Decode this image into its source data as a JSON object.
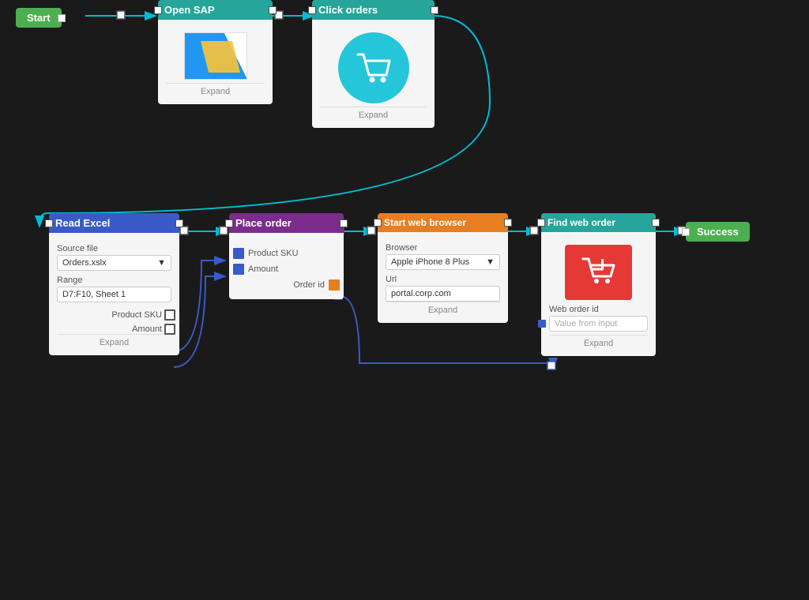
{
  "nodes": {
    "start": {
      "label": "Start"
    },
    "open_sap": {
      "label": "Open SAP",
      "expand": "Expand"
    },
    "click_orders": {
      "label": "Click orders",
      "expand": "Expand"
    },
    "read_excel": {
      "label": "Read Excel",
      "source_file_label": "Source file",
      "source_file_value": "Orders.xslx",
      "range_label": "Range",
      "range_value": "D7:F10, Sheet 1",
      "product_sku_label": "Product SKU",
      "amount_label": "Amount",
      "expand": "Expand"
    },
    "place_order": {
      "label": "Place order",
      "product_sku_label": "Product SKU",
      "amount_label": "Amount",
      "order_id_label": "Order id"
    },
    "start_web_browser": {
      "label": "Start web browser",
      "browser_label": "Browser",
      "browser_value": "Apple iPhone 8 Plus",
      "url_label": "Url",
      "url_value": "portal.corp.com",
      "expand": "Expand"
    },
    "find_web_order": {
      "label": "Find web order",
      "web_order_id_label": "Web order id",
      "web_order_id_placeholder": "Value from input",
      "expand": "Expand"
    },
    "success": {
      "label": "Success"
    }
  },
  "colors": {
    "green": "#4caf50",
    "teal": "#26a69a",
    "purple": "#7b2d8b",
    "orange": "#e67e22",
    "blue": "#3a5bc7",
    "arrow": "#00bcd4",
    "arrow_blue": "#3a5bc7"
  }
}
